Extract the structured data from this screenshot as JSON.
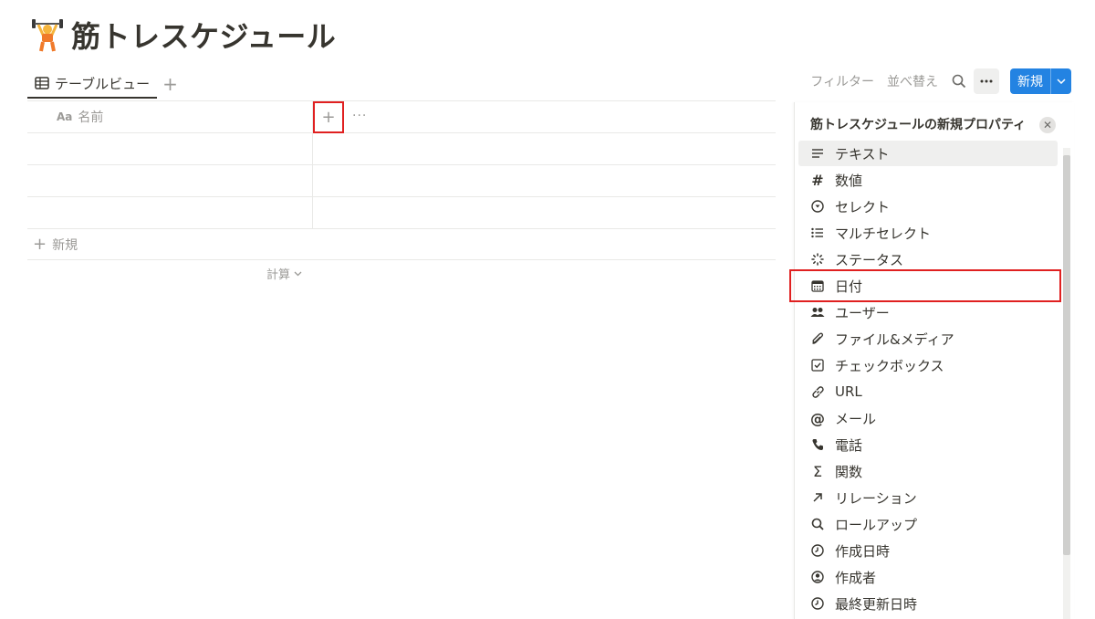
{
  "page": {
    "title": "筋トレスケジュール",
    "icon": "weight-lifter-icon"
  },
  "views": {
    "tabs": [
      {
        "label": "テーブルビュー",
        "icon": "table-icon"
      }
    ],
    "add_icon": "plus-icon"
  },
  "toolbar": {
    "filter": "フィルター",
    "sort": "並べ替え",
    "search_icon": "search-icon",
    "more_icon": "more-icon",
    "new_label": "新規"
  },
  "table": {
    "columns": [
      {
        "label": "名前",
        "type_prefix": "Aa"
      }
    ],
    "rows": [
      "",
      "",
      ""
    ],
    "new_row_label": "新規",
    "calc_label": "計算"
  },
  "panel": {
    "title": "筋トレスケジュールの新規プロパティ",
    "types": [
      {
        "label": "テキスト",
        "icon": "text-icon"
      },
      {
        "label": "数値",
        "icon": "hash-icon"
      },
      {
        "label": "セレクト",
        "icon": "select-icon"
      },
      {
        "label": "マルチセレクト",
        "icon": "multiselect-icon"
      },
      {
        "label": "ステータス",
        "icon": "status-icon"
      },
      {
        "label": "日付",
        "icon": "calendar-icon"
      },
      {
        "label": "ユーザー",
        "icon": "users-icon"
      },
      {
        "label": "ファイル&メディア",
        "icon": "paperclip-icon"
      },
      {
        "label": "チェックボックス",
        "icon": "checkbox-icon"
      },
      {
        "label": "URL",
        "icon": "link-icon"
      },
      {
        "label": "メール",
        "icon": "at-icon"
      },
      {
        "label": "電話",
        "icon": "phone-icon"
      },
      {
        "label": "関数",
        "icon": "sigma-icon"
      },
      {
        "label": "リレーション",
        "icon": "arrow-up-right-icon"
      },
      {
        "label": "ロールアップ",
        "icon": "search-icon"
      },
      {
        "label": "作成日時",
        "icon": "clock-icon"
      },
      {
        "label": "作成者",
        "icon": "user-circle-icon"
      },
      {
        "label": "最終更新日時",
        "icon": "clock-icon"
      }
    ],
    "hovered": "テキスト",
    "highlighted": "日付"
  },
  "colors": {
    "accent": "#2383e2",
    "highlight_box": "#e02020",
    "muted_text": "#9b9a97",
    "text": "#37352f"
  }
}
